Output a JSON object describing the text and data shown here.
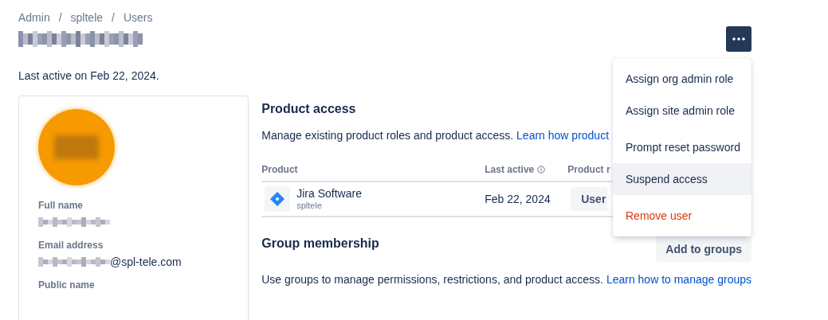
{
  "breadcrumbs": [
    {
      "kind": "link",
      "text": "Admin"
    },
    {
      "kind": "separator",
      "text": "/"
    },
    {
      "kind": "link",
      "text": "spltele"
    },
    {
      "kind": "separator",
      "text": "/"
    },
    {
      "kind": "link",
      "text": "Users"
    }
  ],
  "last_active": "Last active on Feb 22, 2024.",
  "profile": {
    "fields": [
      {
        "label": "Full name",
        "kind": "hidden"
      },
      {
        "label": "Email address",
        "kind": "partial",
        "value": "@spl-tele.com"
      },
      {
        "label": "Public name",
        "kind": "plain"
      }
    ]
  },
  "product_access": {
    "title": "Product access",
    "description": "Manage existing product roles and product access. ",
    "link": "Learn how product",
    "columns": [
      {
        "label": "Product"
      },
      {
        "label": "Last active",
        "info": true
      },
      {
        "label": "Product r"
      }
    ],
    "rows": [
      {
        "product": "Jira Software",
        "site": "spltele",
        "last_active": "Feb 22, 2024",
        "role": "User"
      }
    ]
  },
  "group_membership": {
    "title": "Group membership",
    "button": "Add to groups",
    "description": "Use groups to manage permissions, restrictions, and product access. ",
    "link": "Learn how to manage groups"
  },
  "menu": {
    "sections": [
      {
        "items": [
          {
            "label": "Assign org admin role",
            "kind": "normal",
            "selected": false
          },
          {
            "label": "Assign site admin role",
            "kind": "normal",
            "selected": false
          }
        ]
      },
      {
        "items": [
          {
            "label": "Prompt reset password",
            "kind": "normal",
            "selected": false
          },
          {
            "label": "Suspend access",
            "kind": "normal",
            "selected": true
          }
        ]
      },
      {
        "items": [
          {
            "label": "Remove user",
            "kind": "danger",
            "selected": false
          }
        ]
      }
    ]
  }
}
